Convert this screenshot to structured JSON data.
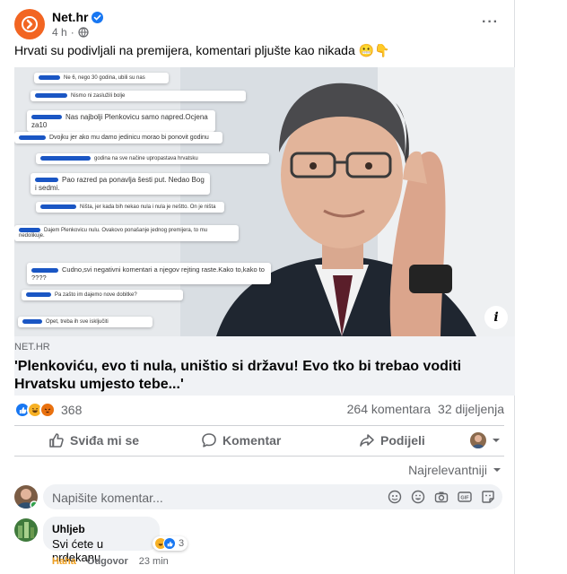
{
  "post": {
    "page_name": "Net.hr",
    "time": "4 h",
    "caption": "Hrvati su podivljali na premijera, komentari pljušte kao nikada 😬👇"
  },
  "collage": [
    "Ne 6, nego 30 godina, ubili su nas",
    "Nismo ni zaslužili bolje",
    "Nas najbolji Plenkovicu samo napred.Ocjena za10",
    "Dvojku jer ako mu damo jedinicu morao bi ponovit godinu",
    "godina na sve načine upropastava hrvatsku",
    "Pao razred pa ponavlja šesti put. Nedao Bog i sedmi.",
    "Ništa, jer kada bih nekao nula i nula je neštto. On je ništa",
    "Dajem Plenkovicu nulu. Ovakovo ponašanje jednog premijera, to mu nedolikuje.",
    "Cudno,svi negativni komentari a njegov rejting raste.Kako to,kako to ????",
    "Pa zašto im dajemo nove dobitke?",
    "Opet, treba ih sve isključiti"
  ],
  "link": {
    "domain": "NET.HR",
    "headline": "'Plenkoviću, evo ti nula, uništio si državu! Evo tko bi trebao voditi Hrvatsku umjesto tebe...'"
  },
  "stats": {
    "reaction_count": "368",
    "comments": "264 komentara",
    "shares": "32 dijeljenja",
    "reactions": [
      "like",
      "haha",
      "angry"
    ]
  },
  "actions": {
    "like": "Sviđa mi se",
    "comment": "Komentar",
    "share": "Podijeli"
  },
  "comments_section": {
    "sort_label": "Najrelevantniji",
    "input_placeholder": "Napišite komentar...",
    "comment": {
      "author": "Uhljeb",
      "text": "Svi ćete u prdekanu",
      "reaction_count": "3",
      "haha": "Haha",
      "reply": "Odgovor",
      "time": "23 min"
    }
  },
  "colors": {
    "brand": "#f26522",
    "accent": "#1877f2",
    "muted": "#65676b"
  }
}
